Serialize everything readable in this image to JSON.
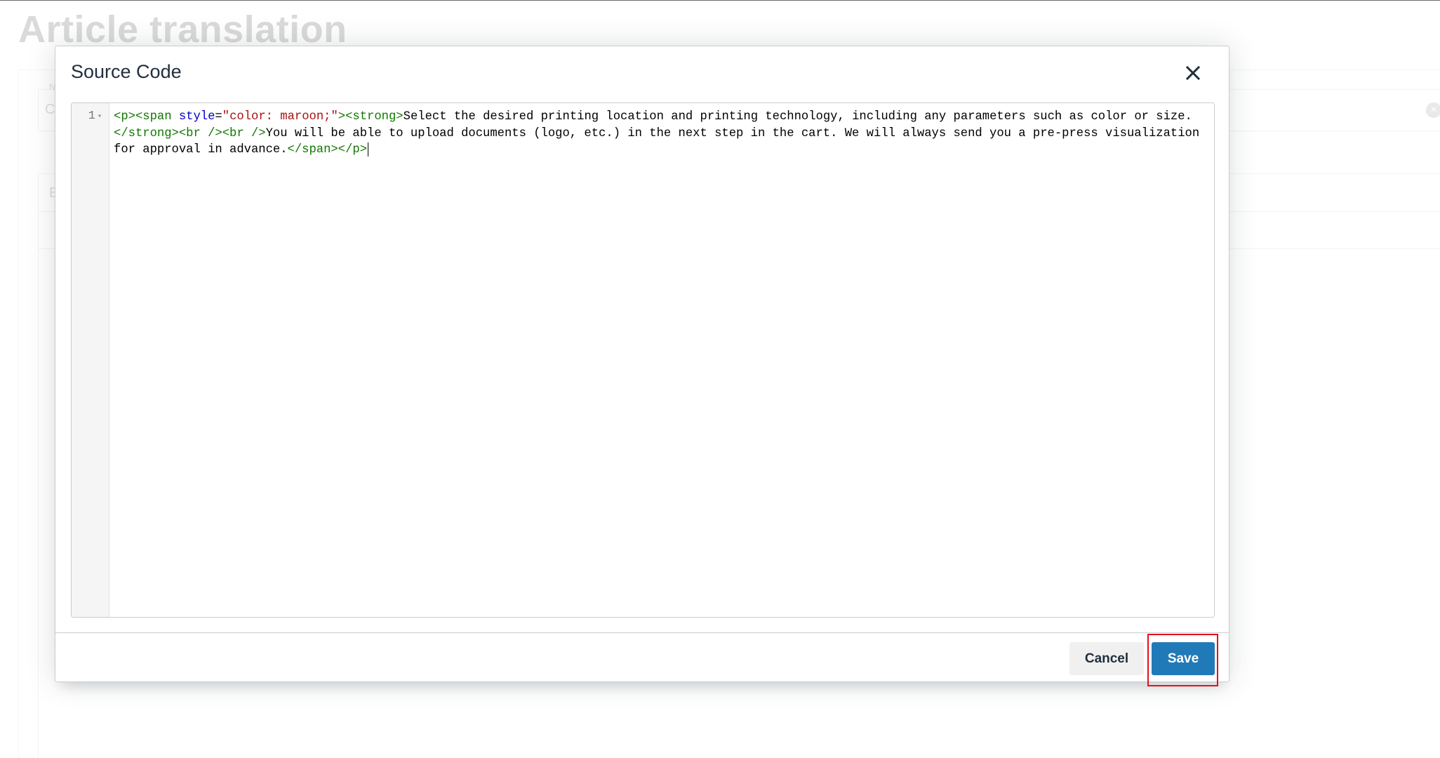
{
  "background": {
    "page_title": "Article translation",
    "fragments": [
      "C",
      "E",
      "N"
    ]
  },
  "dialog": {
    "title": "Source Code",
    "close_icon": "close-icon",
    "editor": {
      "line_number": "1",
      "fold_icon": "chevron-down-icon",
      "tokens": [
        {
          "type": "tag",
          "text": "<p>"
        },
        {
          "type": "tag",
          "text": "<span "
        },
        {
          "type": "attr",
          "text": "style"
        },
        {
          "type": "text",
          "text": "="
        },
        {
          "type": "str",
          "text": "\"color: maroon;\""
        },
        {
          "type": "tag",
          "text": ">"
        },
        {
          "type": "tag",
          "text": "<strong>"
        },
        {
          "type": "text",
          "text": "Select the desired printing location and printing technology, including any parameters such as color or size."
        },
        {
          "type": "tag",
          "text": "</strong>"
        },
        {
          "type": "tag",
          "text": "<br />"
        },
        {
          "type": "tag",
          "text": "<br />"
        },
        {
          "type": "text",
          "text": "You will be able to upload documents (logo, etc.) in the next step in the cart. We will always send you a pre-press visualization for approval in advance."
        },
        {
          "type": "tag",
          "text": "</span>"
        },
        {
          "type": "tag",
          "text": "</p>"
        }
      ]
    },
    "footer": {
      "cancel_label": "Cancel",
      "save_label": "Save"
    }
  },
  "colors": {
    "primary": "#207ab7",
    "highlight": "#e3101b",
    "tag": "#117700",
    "attribute": "#0000cc",
    "string": "#aa1111"
  }
}
